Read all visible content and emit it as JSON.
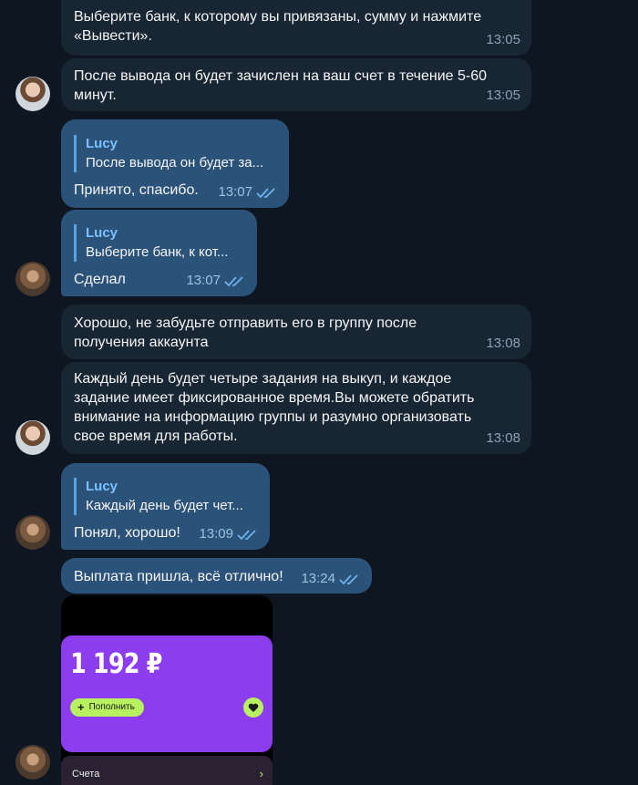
{
  "messages": [
    {
      "text": "Выберите банк, к которому вы привязаны, сумму и нажмите «Вывести».",
      "time": "13:05"
    },
    {
      "text": "После вывода он будет зачислен на ваш счет в течение 5-60 минут.",
      "time": "13:05"
    },
    {
      "reply_name": "Lucy",
      "reply_text": "После вывода он будет за...",
      "text": "Принято, спасибо.",
      "time": "13:07"
    },
    {
      "reply_name": "Lucy",
      "reply_text": "Выберите банк, к кот...",
      "text": "Сделал",
      "time": "13:07"
    },
    {
      "text": "Хорошо, не забудьте отправить его в группу после получения аккаунта",
      "time": "13:08"
    },
    {
      "text": "Каждый день будет четыре задания на выкуп, и каждое задание имеет фиксированное время.Вы можете обратить внимание на информацию группы и разумно организовать свое время для работы.",
      "time": "13:08"
    },
    {
      "reply_name": "Lucy",
      "reply_text": "Каждый день будет чет...",
      "text": "Понял, хорошо!",
      "time": "13:09"
    },
    {
      "text": "Выплата пришла, всё отлично!",
      "time": "13:24"
    }
  ],
  "photo": {
    "amount": "1 192 ₽",
    "topup_label": "Пополнить",
    "accounts_label": "Счета"
  },
  "colors": {
    "background": "#0e1621",
    "incoming_bubble": "#182533",
    "outgoing_bubble": "#2b5278",
    "reply_name": "#7cc0ff",
    "card": "#8c3df0",
    "accent_green": "#b8f15f"
  },
  "icons": [
    "double-check-icon",
    "plus-icon",
    "heart-icon",
    "chevron-right-icon"
  ]
}
